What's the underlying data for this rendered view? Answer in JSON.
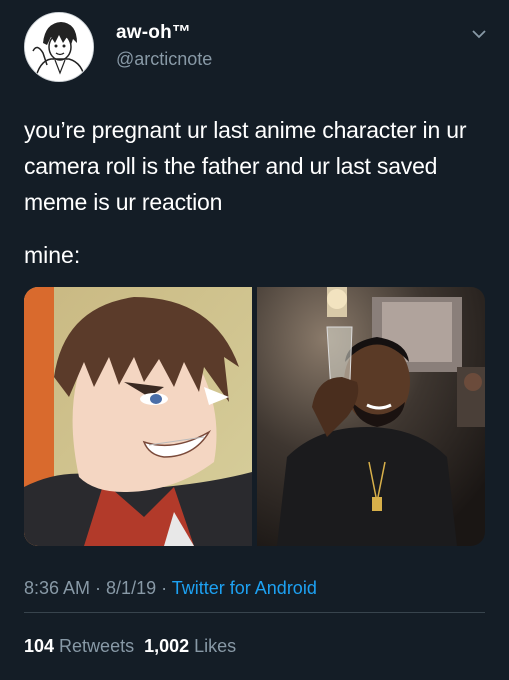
{
  "user": {
    "display_name": "aw-oh™",
    "handle": "@arcticnote",
    "avatar_icon": "avatar-anime-sketch-icon"
  },
  "tweet": {
    "text": "you’re pregnant ur last anime character in ur camera roll is the father and ur last saved meme is ur reaction",
    "mine": "mine:",
    "time": "8:36 AM",
    "sep1": " · ",
    "date": "8/1/19",
    "sep2": " · ",
    "source": "Twitter for Android"
  },
  "stats": {
    "retweets_count": "104",
    "retweets_label": " Retweets",
    "likes_count": "1,002",
    "likes_label": " Likes"
  },
  "media": {
    "left_icon": "anime-character-image",
    "right_icon": "reaction-meme-photo"
  },
  "colors": {
    "background": "#141d26",
    "secondary_text": "#8899a6",
    "link": "#1da1f2",
    "divider": "#38444d"
  }
}
